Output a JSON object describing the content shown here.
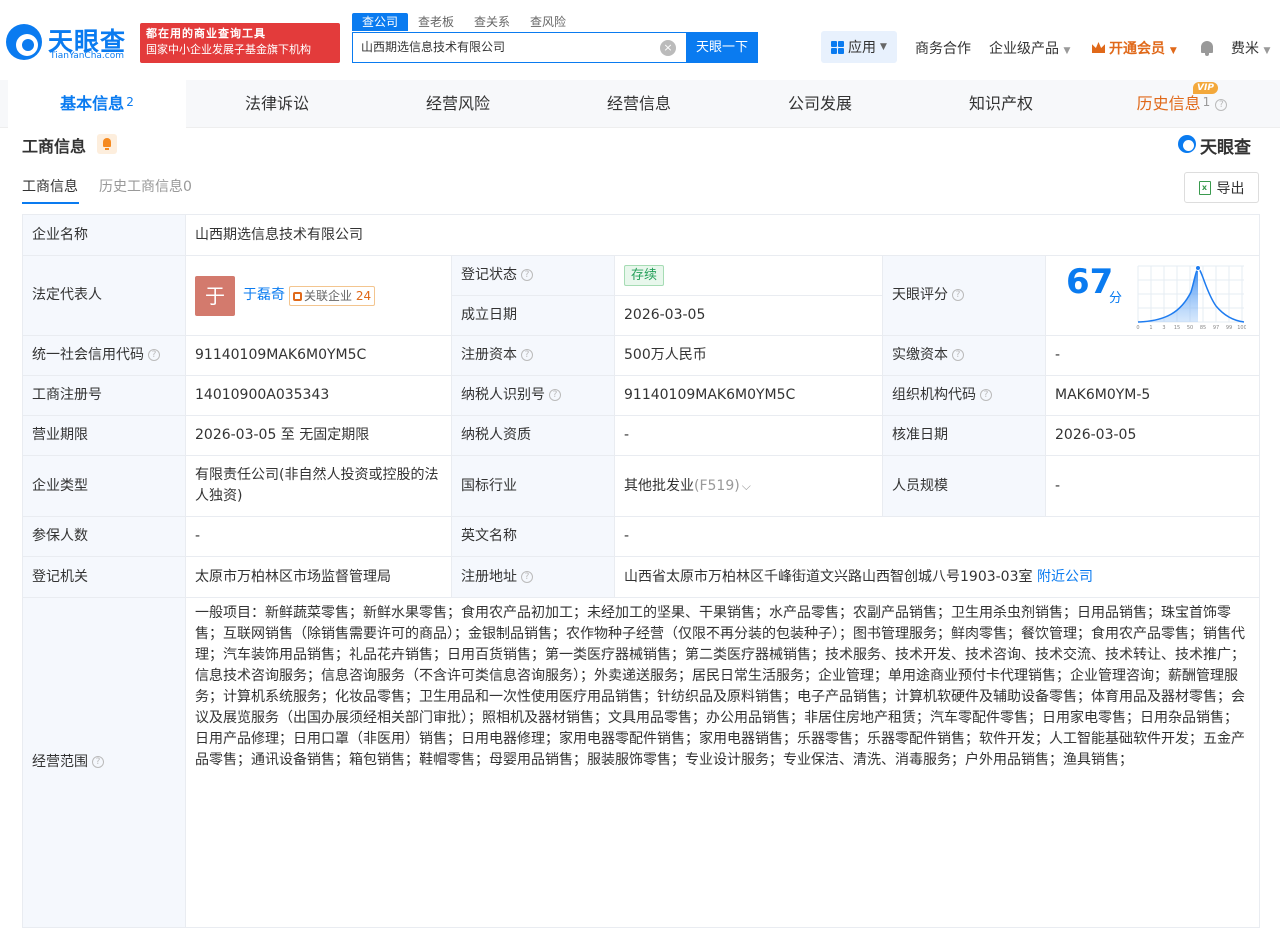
{
  "header": {
    "logo_name": "天眼查",
    "logo_sub": "TianYanCha.com",
    "slogan_line1": "都在用的商业查询工具",
    "slogan_line2": "国家中小企业发展子基金旗下机构",
    "search_tabs": [
      "查公司",
      "查老板",
      "查关系",
      "查风险"
    ],
    "search_value": "山西期选信息技术有限公司",
    "search_button": "天眼一下",
    "app_label": "应用",
    "nav_business": "商务合作",
    "nav_enterprise": "企业级产品",
    "nav_vip": "开通会员",
    "nav_user": "费米"
  },
  "tabs": {
    "basic": "基本信息",
    "basic_count": "2",
    "legal": "法律诉讼",
    "risk": "经营风险",
    "biz": "经营信息",
    "dev": "公司发展",
    "ip": "知识产权",
    "history": "历史信息",
    "history_count": "1",
    "vip_badge": "VIP"
  },
  "section": {
    "title": "工商信息",
    "brand": "天眼查",
    "sub_tab_active": "工商信息",
    "sub_tab_history": "历史工商信息0",
    "export_label": "导出"
  },
  "info": {
    "company_name_label": "企业名称",
    "company_name": "山西期选信息技术有限公司",
    "legal_rep_label": "法定代表人",
    "legal_rep_avatar": "于",
    "legal_rep_name": "于磊奇",
    "related_label": "关联企业",
    "related_count": "24",
    "reg_status_label": "登记状态",
    "reg_status": "存续",
    "founded_label": "成立日期",
    "founded": "2026-03-05",
    "score_label": "天眼评分",
    "score": "67",
    "score_unit": "分",
    "score_axis": [
      "0",
      "1",
      "3",
      "15",
      "50",
      "85",
      "97",
      "99",
      "100"
    ],
    "credit_code_label": "统一社会信用代码",
    "credit_code": "91140109MAK6M0YM5C",
    "reg_capital_label": "注册资本",
    "reg_capital": "500万人民币",
    "paid_capital_label": "实缴资本",
    "paid_capital": "-",
    "reg_no_label": "工商注册号",
    "reg_no": "14010900A035343",
    "taxpayer_id_label": "纳税人识别号",
    "taxpayer_id": "91140109MAK6M0YM5C",
    "org_code_label": "组织机构代码",
    "org_code": "MAK6M0YM-5",
    "term_label": "营业期限",
    "term": "2026-03-05 至 无固定期限",
    "taxpayer_qual_label": "纳税人资质",
    "taxpayer_qual": "-",
    "approval_date_label": "核准日期",
    "approval_date": "2026-03-05",
    "type_label": "企业类型",
    "type": "有限责任公司(非自然人投资或控股的法人独资)",
    "industry_label": "国标行业",
    "industry": "其他批发业",
    "industry_code": "(F519)",
    "staff_label": "人员规模",
    "staff": "-",
    "insured_label": "参保人数",
    "insured": "-",
    "english_label": "英文名称",
    "english": "-",
    "authority_label": "登记机关",
    "authority": "太原市万柏林区市场监督管理局",
    "address_label": "注册地址",
    "address": "山西省太原市万柏林区千峰街道文兴路山西智创城八号1903-03室",
    "nearby_link": "附近公司",
    "scope_label": "经营范围",
    "scope": "一般项目：新鲜蔬菜零售；新鲜水果零售；食用农产品初加工；未经加工的坚果、干果销售；水产品零售；农副产品销售；卫生用杀虫剂销售；日用品销售；珠宝首饰零售；互联网销售（除销售需要许可的商品）；金银制品销售；农作物种子经营（仅限不再分装的包装种子）；图书管理服务；鲜肉零售；餐饮管理；食用农产品零售；销售代理；汽车装饰用品销售；礼品花卉销售；日用百货销售；第一类医疗器械销售；第二类医疗器械销售；技术服务、技术开发、技术咨询、技术交流、技术转让、技术推广；信息技术咨询服务；信息咨询服务（不含许可类信息咨询服务）；外卖递送服务；居民日常生活服务；企业管理；单用途商业预付卡代理销售；企业管理咨询；薪酬管理服务；计算机系统服务；化妆品零售；卫生用品和一次性使用医疗用品销售；针纺织品及原料销售；电子产品销售；计算机软硬件及辅助设备零售；体育用品及器材零售；会议及展览服务（出国办展须经相关部门审批）；照相机及器材销售；文具用品零售；办公用品销售；非居住房地产租赁；汽车零配件零售；日用家电零售；日用杂品销售；日用产品修理；日用口罩（非医用）销售；日用电器修理；家用电器零配件销售；家用电器销售；乐器零售；乐器零配件销售；软件开发；人工智能基础软件开发；五金产品零售；通讯设备销售；箱包销售；鞋帽零售；母婴用品销售；服装服饰零售；专业设计服务；专业保洁、清洗、消毒服务；户外用品销售；渔具销售；"
  }
}
